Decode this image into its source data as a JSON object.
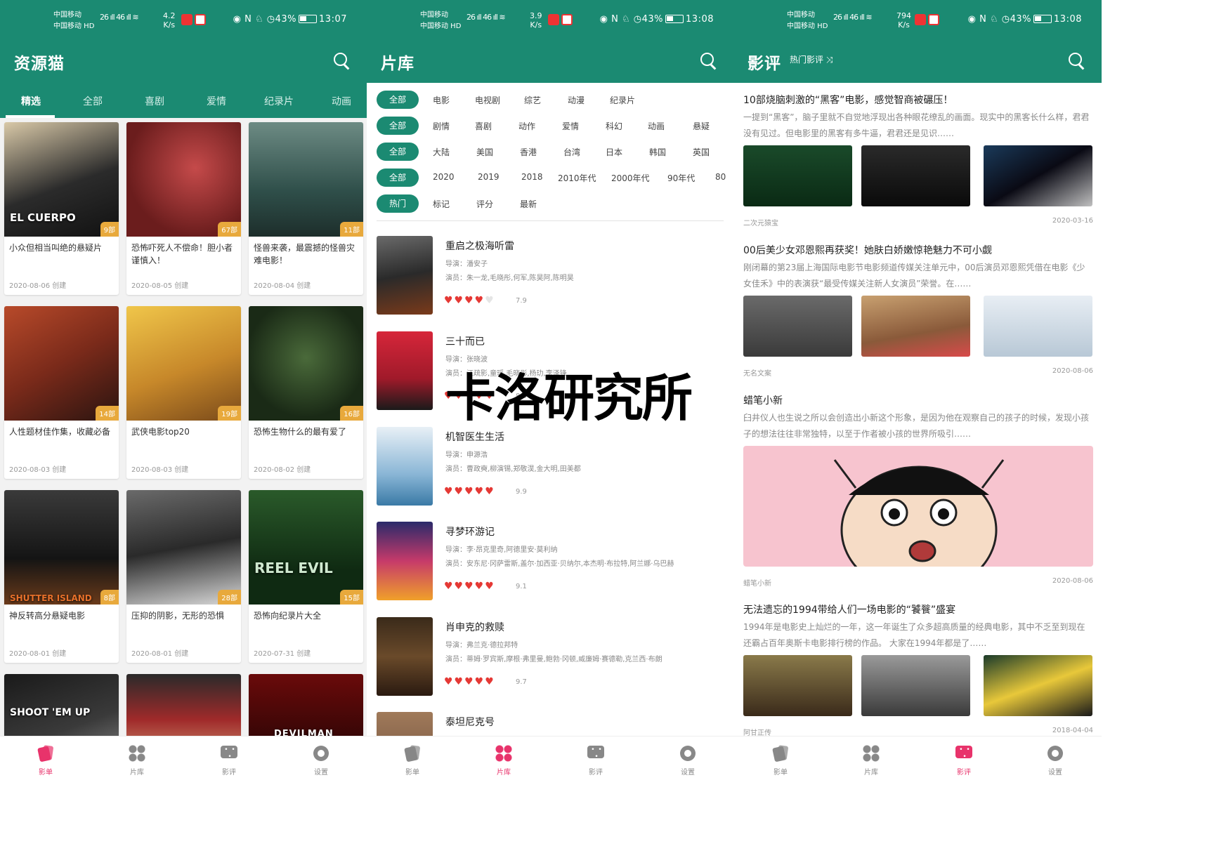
{
  "status_bars": [
    {
      "carrier1": "中国移动",
      "carrier2": "中国移动 HD",
      "signal": "26 ıll 46 ıll ≋",
      "speed": "4.2",
      "speed_unit": "K/s",
      "right": "◉ N ♘ ◷43%",
      "time": "13:07"
    },
    {
      "carrier1": "中国移动",
      "carrier2": "中国移动 HD",
      "signal": "26 ıll 46 ıll ≋",
      "speed": "3.9",
      "speed_unit": "K/s",
      "right": "◉ N ♘ ◷43%",
      "time": "13:08"
    },
    {
      "carrier1": "中国移动",
      "carrier2": "中国移动 HD",
      "signal": "26 ıll 46 ıll ≋",
      "speed": "794",
      "speed_unit": "K/s",
      "right": "◉ N ♘ ◷43%",
      "time": "13:08"
    }
  ],
  "accent": "#1b8a72",
  "nav_active_color": "#e8336b",
  "panel1": {
    "title": "资源猫",
    "tabs": [
      "精选",
      "全部",
      "喜剧",
      "爱情",
      "纪录片",
      "动画"
    ],
    "cards": [
      {
        "title": "小众但相当叫绝的悬疑片",
        "count": "9部",
        "date": "2020-08-06 创建",
        "poster_text": "EL CUERPO"
      },
      {
        "title": "恐怖吓死人不偿命！胆小者谨慎入！",
        "count": "67部",
        "date": "2020-08-05 创建",
        "poster_text": ""
      },
      {
        "title": "怪兽来袭，最震撼的怪兽灾难电影！",
        "count": "11部",
        "date": "2020-08-04 创建",
        "poster_text": ""
      },
      {
        "title": "人性题材佳作集，收藏必备",
        "count": "14部",
        "date": "2020-08-03 创建",
        "poster_text": ""
      },
      {
        "title": "武侠电影top20",
        "count": "19部",
        "date": "2020-08-03 创建",
        "poster_text": ""
      },
      {
        "title": "恐怖生物什么的最有爱了",
        "count": "16部",
        "date": "2020-08-02 创建",
        "poster_text": ""
      },
      {
        "title": "神反转高分悬疑电影",
        "count": "8部",
        "date": "2020-08-01 创建",
        "poster_text": "SHUTTER ISLAND"
      },
      {
        "title": "压抑的阴影，无形的恐惧",
        "count": "28部",
        "date": "2020-08-01 创建",
        "poster_text": ""
      },
      {
        "title": "恐怖向纪录片大全",
        "count": "15部",
        "date": "2020-07-31 创建",
        "poster_text": "REEL EVIL"
      },
      {
        "title": "",
        "count": "",
        "date": "",
        "poster_text": "SHOOT 'EM UP"
      },
      {
        "title": "",
        "count": "",
        "date": "",
        "poster_text": ""
      },
      {
        "title": "",
        "count": "",
        "date": "",
        "poster_text": "DEVILMAN"
      }
    ]
  },
  "panel2": {
    "title": "片库",
    "filters": [
      {
        "chip": "全部",
        "options": [
          "电影",
          "电视剧",
          "综艺",
          "动漫",
          "纪录片"
        ]
      },
      {
        "chip": "全部",
        "options": [
          "剧情",
          "喜剧",
          "动作",
          "爱情",
          "科幻",
          "动画",
          "悬疑"
        ]
      },
      {
        "chip": "全部",
        "options": [
          "大陆",
          "美国",
          "香港",
          "台湾",
          "日本",
          "韩国",
          "英国"
        ]
      },
      {
        "chip": "全部",
        "options": [
          "2020",
          "2019",
          "2018",
          "2010年代",
          "2000年代",
          "90年代",
          "80"
        ]
      },
      {
        "chip": "热门",
        "options": [
          "标记",
          "评分",
          "最新"
        ]
      }
    ],
    "movies": [
      {
        "title": "重启之极海听雷",
        "director": "导演：潘安子",
        "cast": "演员：朱一龙,毛晓彤,何军,陈昊阿,陈明昊",
        "hearts": 4,
        "score": "7.9"
      },
      {
        "title": "三十而已",
        "director": "导演：张晓波",
        "cast": "演员：江疏影,童瑶,毛晓彤,杨玏,李泽锋",
        "hearts": 5,
        "score": "8.0"
      },
      {
        "title": "机智医生生活",
        "director": "导演：申源浩",
        "cast": "演员：曹政奭,柳演锡,郑敬淏,金大明,田美都",
        "hearts": 5,
        "score": "9.9"
      },
      {
        "title": "寻梦环游记",
        "director": "导演：李·昂克里奇,阿德里安·莫利纳",
        "cast": "演员：安东尼·冈萨雷斯,盖尔·加西亚·贝纳尔,本杰明·布拉特,阿兰娜·乌巴赫",
        "hearts": 5,
        "score": "9.1"
      },
      {
        "title": "肖申克的救赎",
        "director": "导演：弗兰克·德拉邦特",
        "cast": "演员：蒂姆·罗宾斯,摩根·弗里曼,鲍勃·冈顿,威廉姆·赛德勒,克兰西·布朗",
        "hearts": 5,
        "score": "9.7"
      },
      {
        "title": "泰坦尼克号",
        "director": "",
        "cast": "",
        "hearts": 0,
        "score": ""
      }
    ],
    "watermark": "卡洛研究所"
  },
  "panel3": {
    "title": "影评",
    "subtitle": "热门影评",
    "articles": [
      {
        "title": "10部烧脑刺激的“黑客”电影，感觉智商被碾压！",
        "desc": "一提到“黑客”，脑子里就不自觉地浮现出各种眼花缭乱的画面。现实中的黑客长什么样，君君没有见过。但电影里的黑客有多牛逼，君君还是见识……",
        "author": "二次元猿宝",
        "date": "2020-03-16"
      },
      {
        "title": "00后美少女邓恩熙再获奖！她肤白娇嫩惊艳魅力不可小觑",
        "desc": "刚闭幕的第23届上海国际电影节电影频道传媒关注单元中，00后演员邓恩熙凭借在电影《少女佳禾》中的表演获“最受传媒关注新人女演员”荣誉。在……",
        "author": "无名文案",
        "date": "2020-08-06"
      },
      {
        "title": "蜡笔小新",
        "desc": "臼井仪人也生说之所以会创造出小新这个形象，是因为他在观察自己的孩子的时候，发现小孩子的想法往往非常独特，以至于作者被小孩的世界所吸引……",
        "author": "蜡笔小新",
        "date": "2020-08-06"
      },
      {
        "title": "无法遗忘的1994带给人们一场电影的“饕餮”盛宴",
        "desc": "1994年是电影史上灿烂的一年，这一年诞生了众多超高质量的经典电影，其中不乏至到现在还霸占百年奥斯卡电影排行榜的作品。 大家在1994年都是了……",
        "author": "阿甘正传",
        "date": "2018-04-04"
      }
    ]
  },
  "bottom_nav": [
    "影单",
    "片库",
    "影评",
    "设置"
  ]
}
